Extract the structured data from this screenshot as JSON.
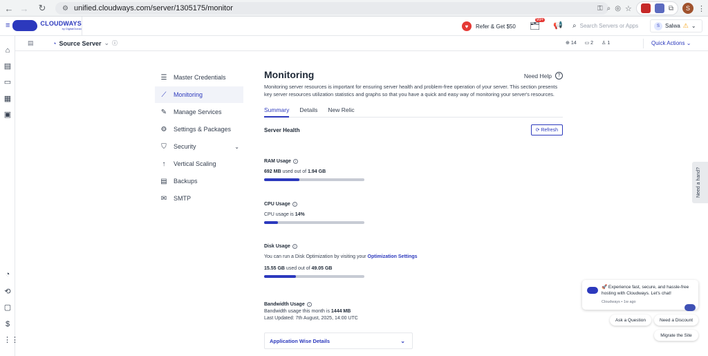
{
  "browser": {
    "url": "unified.cloudways.com/server/1305175/monitor",
    "profile_initial": "S"
  },
  "header": {
    "logo_text": "CLOUDWAYS",
    "logo_sub": "by DigitalOcean",
    "refer_label": "Refer & Get $50",
    "notifications_badge": "99+",
    "search_placeholder": "Search Servers or Apps",
    "user_initial": "S",
    "user_name": "Salwa"
  },
  "subheader": {
    "server_name": "Source Server",
    "apps_count": "14",
    "folders_count": "2",
    "users_count": "1",
    "quick_actions": "Quick Actions"
  },
  "sidebar": {
    "items": [
      {
        "label": "Master Credentials",
        "icon": "list-icon"
      },
      {
        "label": "Monitoring",
        "icon": "chart-line-icon"
      },
      {
        "label": "Manage Services",
        "icon": "tools-icon"
      },
      {
        "label": "Settings & Packages",
        "icon": "gear-icon"
      },
      {
        "label": "Security",
        "icon": "shield-icon"
      },
      {
        "label": "Vertical Scaling",
        "icon": "arrow-up-icon"
      },
      {
        "label": "Backups",
        "icon": "backup-icon"
      },
      {
        "label": "SMTP",
        "icon": "mail-icon"
      }
    ]
  },
  "main": {
    "title": "Monitoring",
    "need_help": "Need Help",
    "description": "Monitoring server resources is important for ensuring server health and problem-free operation of your server. This section presents key server resources utilization statistics and graphs so that you have a quick and easy way of monitoring your server's resources.",
    "tabs": [
      "Summary",
      "Details",
      "New Relic"
    ],
    "server_health": "Server Health",
    "refresh": "Refresh",
    "ram": {
      "title": "RAM Usage",
      "used": "692 MB",
      "mid": "used out of",
      "total": "1.94 GB",
      "fill": 0.35
    },
    "cpu": {
      "title": "CPU Usage",
      "prefix": "CPU usage is",
      "value": "14%",
      "fill": 0.14
    },
    "disk": {
      "title": "Disk Usage",
      "note_prefix": "You can run a Disk Optimization by visiting your",
      "note_link": "Optimization Settings",
      "used": "15.55 GB",
      "mid": "used out of",
      "total": "49.05 GB",
      "fill": 0.32
    },
    "bandwidth": {
      "title": "Bandwidth Usage",
      "prefix": "Bandwidth usage this month is",
      "value": "1444 MB",
      "updated": "Last Updated: 7th August, 2025, 14:00 UTC"
    },
    "app_wise": "Application Wise Details"
  },
  "need_hand": "Need a hand?",
  "chat": {
    "message": "🚀 Experience fast, secure, and hassle-free hosting with Cloudways. Let's chat!",
    "meta": "Cloudways • 1w ago",
    "btn_ask": "Ask a Question",
    "btn_discount": "Need a Discount",
    "btn_migrate": "Migrate the Site"
  }
}
